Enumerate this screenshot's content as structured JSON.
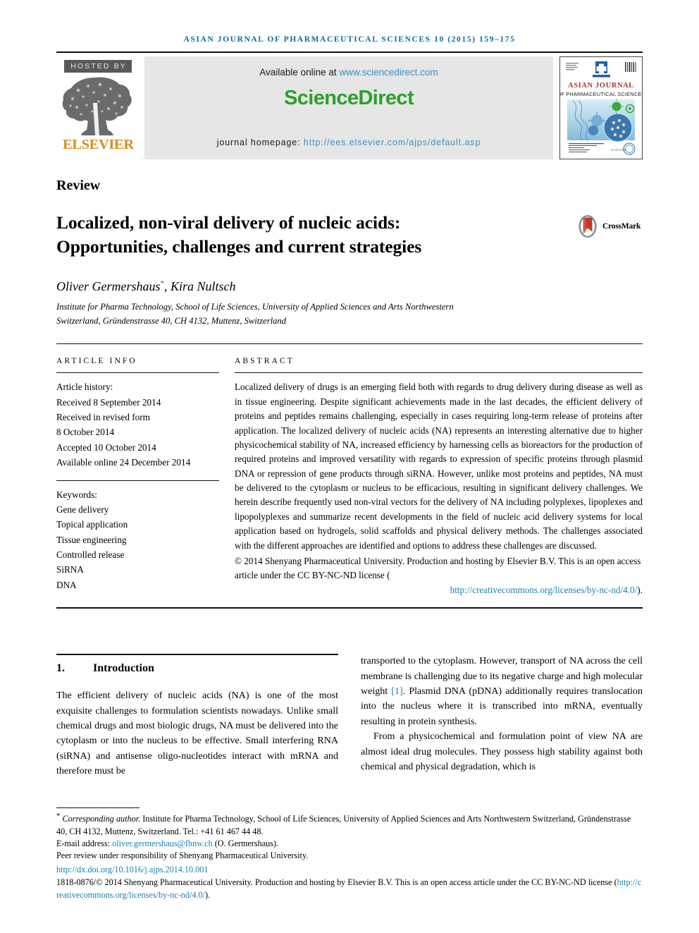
{
  "header": {
    "journal_citation": "Asian Journal of Pharmaceutical Sciences 10 (2015) 159–175",
    "hosted_by": "HOSTED BY",
    "publisher_name": "ELSEVIER",
    "available_online_prefix": "Available online at ",
    "sciencedirect_url": "www.sciencedirect.com",
    "sciencedirect_logo": "ScienceDirect",
    "homepage_prefix": "journal homepage: ",
    "homepage_url": "http://ees.elsevier.com/ajps/default.asp",
    "cover": {
      "title_line1": "ASIAN JOURNAL",
      "title_line2": "OF PHARMACEUTICAL SCIENCES",
      "masthead_label": "ASIAN JOURNAL",
      "footer_line1": "Asian Journal of Pharmaceutical Sciences",
      "footer_line2": "Production and hosting by",
      "footer_line3": "ELSEVIER",
      "footer_line4": "Shenyang Pharmaceutical University"
    }
  },
  "article": {
    "type": "Review",
    "title_line1": "Localized, non-viral delivery of nucleic acids:",
    "title_line2": "Opportunities, challenges and current strategies",
    "crossmark_label": "CrossMark",
    "authors": "Oliver Germershaus",
    "author_marker": "*",
    "authors_rest": ", Kira Nultsch",
    "affiliation_line1": "Institute for Pharma Technology, School of Life Sciences, University of Applied Sciences and Arts Northwestern",
    "affiliation_line2": "Switzerland, Gründenstrasse 40, CH 4132, Muttenz, Switzerland"
  },
  "article_info": {
    "heading": "ARTICLE INFO",
    "history_label": "Article history:",
    "history": [
      "Received 8 September 2014",
      "Received in revised form",
      "8 October 2014",
      "Accepted 10 October 2014",
      "Available online 24 December 2014"
    ],
    "keywords_label": "Keywords:",
    "keywords": [
      "Gene delivery",
      "Topical application",
      "Tissue engineering",
      "Controlled release",
      "SiRNA",
      "DNA"
    ]
  },
  "abstract": {
    "heading": "ABSTRACT",
    "text": "Localized delivery of drugs is an emerging field both with regards to drug delivery during disease as well as in tissue engineering. Despite significant achievements made in the last decades, the efficient delivery of proteins and peptides remains challenging, especially in cases requiring long-term release of proteins after application. The localized delivery of nucleic acids (NA) represents an interesting alternative due to higher physicochemical stability of NA, increased efficiency by harnessing cells as bioreactors for the production of required proteins and improved versatility with regards to expression of specific proteins through plasmid DNA or repression of gene products through siRNA. However, unlike most proteins and peptides, NA must be delivered to the cytoplasm or nucleus to be efficacious, resulting in significant delivery challenges. We herein describe frequently used non-viral vectors for the delivery of NA including polyplexes, lipoplexes and lipopolyplexes and summarize recent developments in the field of nucleic acid delivery systems for local application based on hydrogels, solid scaffolds and physical delivery methods. The challenges associated with the different approaches are identified and options to address these challenges are discussed.",
    "copyright": "© 2014 Shenyang Pharmaceutical University. Production and hosting by Elsevier B.V. This is an open access article under the CC BY-NC-ND license (",
    "copyright_link": "http://creativecommons.org/licenses/by-nc-nd/4.0/",
    "copyright_end": ")."
  },
  "body": {
    "section_number": "1.",
    "section_title": "Introduction",
    "left_paragraph": "The efficient delivery of nucleic acids (NA) is one of the most exquisite challenges to formulation scientists nowadays. Unlike small chemical drugs and most biologic drugs, NA must be delivered into the cytoplasm or into the nucleus to be effective. Small interfering RNA (siRNA) and antisense oligo-nucleotides interact with mRNA and therefore must be",
    "right_paragraph_1_a": "transported to the cytoplasm. However, transport of NA across the cell membrane is challenging due to its negative charge and high molecular weight ",
    "right_paragraph_1_ref": "[1]",
    "right_paragraph_1_b": ". Plasmid DNA (pDNA) additionally requires translocation into the nucleus where it is transcribed into mRNA, eventually resulting in protein synthesis.",
    "right_paragraph_2": "From a physicochemical and formulation point of view NA are almost ideal drug molecules. They possess high stability against both chemical and physical degradation, which is"
  },
  "footnotes": {
    "corresponding_marker": "*",
    "corresponding_label": "Corresponding author.",
    "corresponding_rest": " Institute for Pharma Technology, School of Life Sciences, University of Applied Sciences and Arts Northwestern Switzerland, Gründenstrasse 40, CH 4132, Muttenz, Switzerland. Tel.: +41 61 467 44 48.",
    "email_label": "E-mail address: ",
    "email": "oliver.germershaus@fhnw.ch",
    "email_suffix": " (O. Germershaus).",
    "peer_review": "Peer review under responsibility of Shenyang Pharmaceutical University.",
    "doi": "http://dx.doi.org/10.1016/j.ajps.2014.10.001",
    "issn_line": "1818-0876/© 2014 Shenyang Pharmaceutical University. Production and hosting by Elsevier B.V. This is an open access article under the CC BY-NC-ND license (",
    "issn_link": "http://creativecommons.org/licenses/by-nc-nd/4.0/",
    "issn_end": ")."
  },
  "colors": {
    "journal_blue": "#0b6ea0",
    "link_blue": "#1a7fb5",
    "sciencedirect_green": "#2ba02b",
    "elsevier_orange": "#d98c1f",
    "banner_gray": "#e6e6e6"
  }
}
